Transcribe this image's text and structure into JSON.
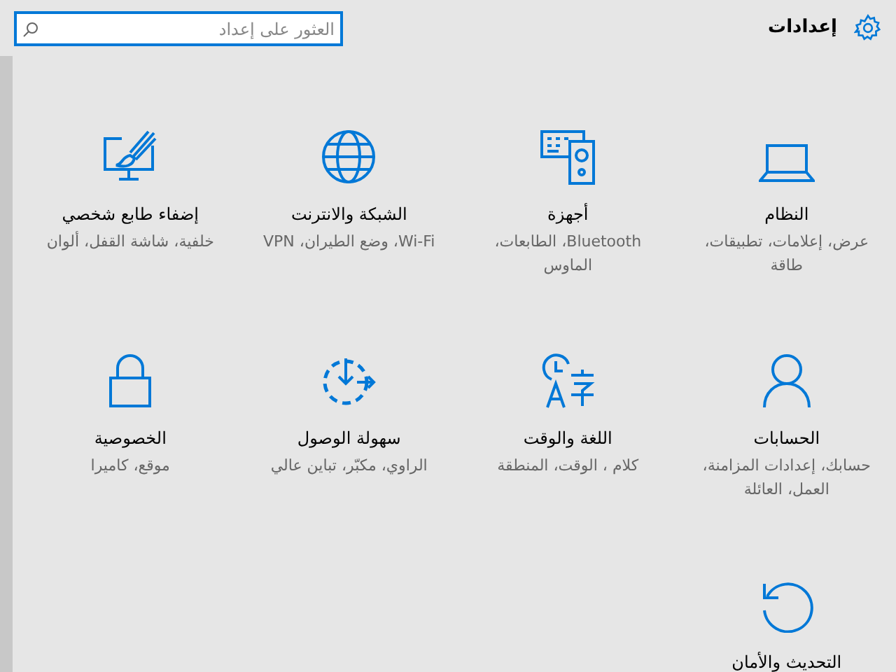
{
  "header": {
    "title": "إعدادات",
    "search": {
      "placeholder": "العثور على إعداد"
    }
  },
  "tiles": [
    {
      "title": "النظام",
      "subtitle": "عرض، إعلامات، تطبيقات، طاقة"
    },
    {
      "title": "أجهزة",
      "subtitle": "Bluetooth، الطابعات، الماوس"
    },
    {
      "title": "الشبكة والانترنت",
      "subtitle": "Wi-Fi، وضع الطيران، VPN"
    },
    {
      "title": "إضفاء طابع شخصي",
      "subtitle": "خلفية، شاشة القفل، ألوان"
    },
    {
      "title": "الحسابات",
      "subtitle": "حسابك، إعدادات المزامنة، العمل، العائلة"
    },
    {
      "title": "اللغة والوقت",
      "subtitle": "كلام ، الوقت، المنطقة"
    },
    {
      "title": "سهولة الوصول",
      "subtitle": "الراوي، مكبّر، تباين عالي"
    },
    {
      "title": "الخصوصية",
      "subtitle": "موقع، كاميرا"
    },
    {
      "title": "التحديث والأمان"
    }
  ]
}
